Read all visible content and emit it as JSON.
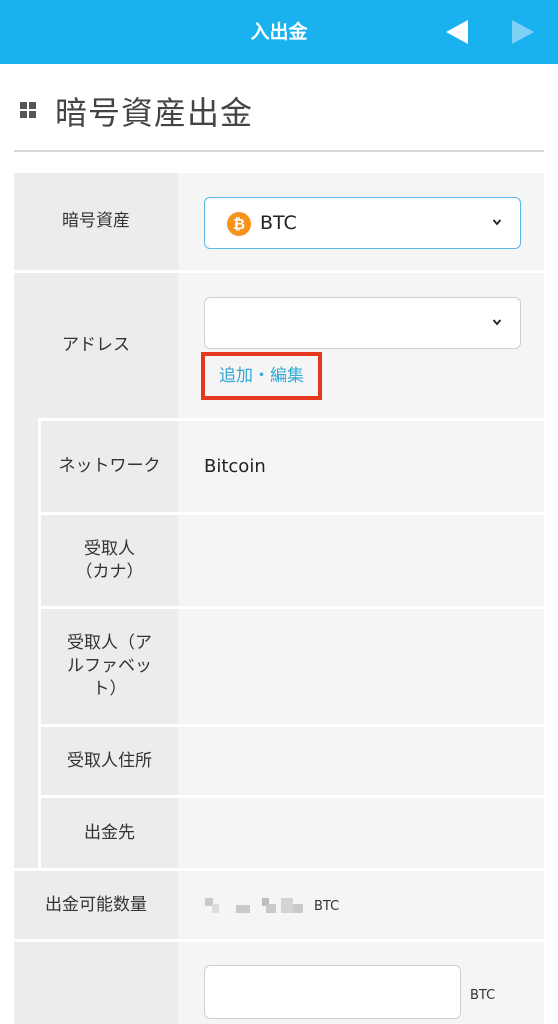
{
  "header": {
    "title": "入出金",
    "prev_icon": "triangle-left-icon",
    "next_icon": "triangle-right-icon",
    "colors": {
      "bar": "#1ab1ef",
      "prev_active": "#ffffff",
      "next_disabled": "#7fd0f5"
    }
  },
  "page": {
    "title": "暗号資産出金",
    "title_icon": "grid-icon"
  },
  "form": {
    "asset": {
      "label": "暗号資産",
      "selected": "BTC",
      "coin_icon": "bitcoin-coin-icon",
      "coin_symbol": "₿"
    },
    "address": {
      "label": "アドレス",
      "selected": "",
      "add_edit_link": "追加・編集"
    },
    "network": {
      "label": "ネットワーク",
      "value": "Bitcoin"
    },
    "recipient_kana": {
      "label": "受取人（カナ）",
      "value": ""
    },
    "recipient_alpha": {
      "label": "受取人（アルファベット）",
      "value": ""
    },
    "recipient_address": {
      "label": "受取人住所",
      "value": ""
    },
    "destination": {
      "label": "出金先",
      "value": ""
    },
    "available": {
      "label": "出金可能数量",
      "unit": "BTC"
    },
    "amount": {
      "label": "",
      "value": "",
      "unit": "BTC"
    }
  },
  "colors": {
    "link": "#34a8d6",
    "highlight_border": "#e4391e",
    "coin": "#f7931a"
  }
}
